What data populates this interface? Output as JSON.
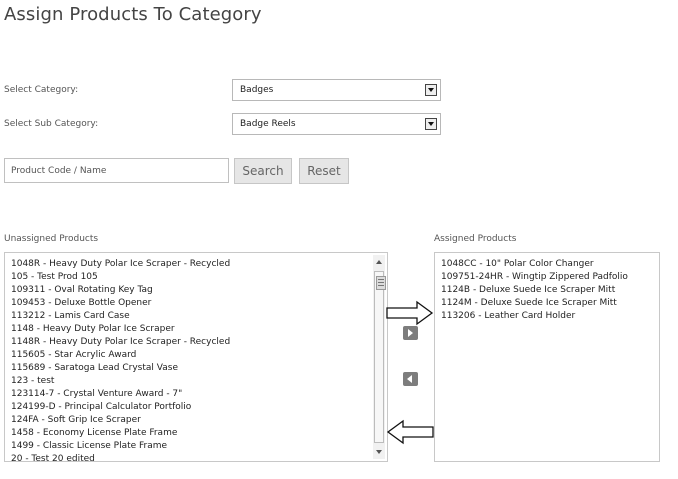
{
  "page": {
    "title": "Assign Products To Category"
  },
  "filters": {
    "category_label": "Select Category:",
    "category_value": "Badges",
    "subcategory_label": "Select Sub Category:",
    "subcategory_value": "Badge Reels"
  },
  "search": {
    "placeholder": "Product Code / Name",
    "search_label": "Search",
    "reset_label": "Reset"
  },
  "unassigned": {
    "label": "Unassigned Products",
    "items": [
      "1048R - Heavy Duty Polar Ice Scraper - Recycled",
      "105 - Test Prod 105",
      "109311 - Oval Rotating Key Tag",
      "109453 - Deluxe Bottle Opener",
      "113212 - Lamis Card Case",
      "1148 - Heavy Duty Polar Ice Scraper",
      "1148R - Heavy Duty Polar Ice Scraper - Recycled",
      "115605 - Star Acrylic Award",
      "115689 - Saratoga Lead Crystal Vase",
      "123 - test",
      "123114-7 - Crystal Venture Award - 7\"",
      "124199-D - Principal Calculator Portfolio",
      "124FA - Soft Grip Ice Scraper",
      "1458 - Economy License Plate Frame",
      "1499 - Classic License Plate Frame",
      "20 - Test 20 edited"
    ]
  },
  "assigned": {
    "label": "Assigned Products",
    "items": [
      "1048CC - 10\" Polar Color Changer",
      "109751-24HR - Wingtip Zippered Padfolio",
      "1124B - Deluxe Suede Ice Scraper Mitt",
      "1124M - Deluxe Suede Ice Scraper Mitt",
      "113206 - Leather Card Holder"
    ]
  },
  "icons": {
    "move_right": "triangle-right-icon",
    "move_left": "triangle-left-icon",
    "annotation_right": "outline-arrow-right-icon",
    "annotation_left": "outline-arrow-left-icon"
  },
  "colors": {
    "title": "#444444",
    "button_bg": "#e6e6e6",
    "move_button": "#7d7d7d"
  }
}
